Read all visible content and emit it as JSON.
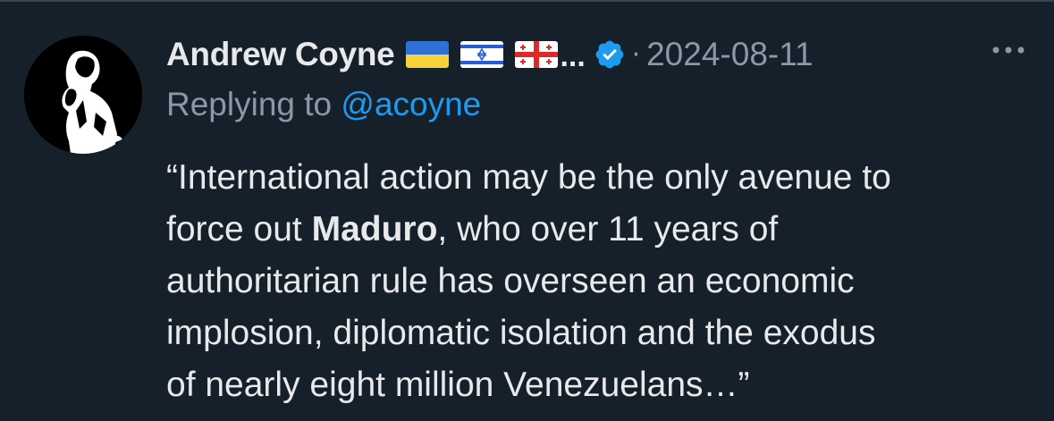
{
  "tweet": {
    "author_name": "Andrew Coyne",
    "flags": [
      "ukraine-flag",
      "israel-flag",
      "georgia-flag"
    ],
    "name_ellipsis": "...",
    "separator": "·",
    "date": "2024-08-11",
    "reply_prefix": "Replying to ",
    "reply_handle": "@acoyne",
    "body": {
      "line1": "“International action may be the only avenue to",
      "line2_pre": "force out ",
      "line2_bold": "Maduro",
      "line2_post": ", who over 11 years of",
      "line3": "authoritarian rule has overseen an economic",
      "line4": "implosion, diplomatic isolation and the exodus",
      "line5": "of nearly eight million Venezuelans…”"
    }
  },
  "colors": {
    "background": "#15202b",
    "text_primary": "#e7e9ea",
    "text_secondary": "#8b98a5",
    "link": "#1d9bf0",
    "verified": "#1d9bf0"
  }
}
